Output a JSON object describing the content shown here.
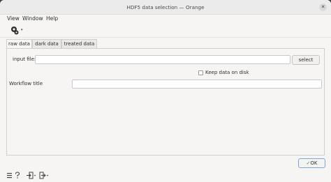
{
  "window": {
    "title": "HDF5 data selection — Orange",
    "close_glyph": "✕"
  },
  "menu": {
    "items": [
      "View",
      "Window",
      "Help"
    ]
  },
  "toolbar": {
    "icon": "gear-settings-icon",
    "arrow": "▾"
  },
  "tabs": [
    {
      "label": "raw data",
      "active": true
    },
    {
      "label": "dark data",
      "active": false
    },
    {
      "label": "treated data",
      "active": false
    }
  ],
  "form": {
    "input_file_label": "input file:",
    "input_file_value": "",
    "select_label": "select",
    "keep_data_label": "Keep data on disk",
    "keep_data_checked": false,
    "workflow_title_label": "Workflow title",
    "workflow_title_value": ""
  },
  "footer": {
    "ok_label": "OK",
    "ok_check": "✓"
  },
  "status_icons": [
    "menu-icon",
    "help-icon",
    "input-icon",
    "output-icon"
  ],
  "colors": {
    "focus_border": "#7aa7d6",
    "ok_check": "#3a8a3a"
  }
}
